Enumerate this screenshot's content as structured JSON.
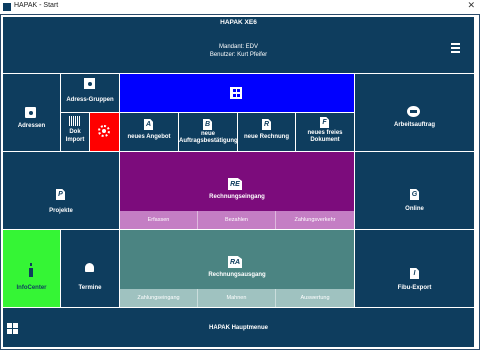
{
  "window": {
    "title": "HAPAK - Start",
    "close_glyph": "✕"
  },
  "header": {
    "title": "HAPAK XE6",
    "mandant": "Mandant: EDV",
    "benutzer": "Benutzer: Kurt Pfeifer"
  },
  "tiles": {
    "adressen": "Adressen",
    "adress_gruppen": "Adress-Gruppen",
    "dok_import_1": "Dok",
    "dok_import_2": "Import",
    "neues_angebot": "neues Angebot",
    "neue_auftragsbestaetigung_1": "neue",
    "neue_auftragsbestaetigung_2": "Auftragsbestätigung",
    "neue_rechnung": "neue Rechnung",
    "neues_freies_dokument_1": "neues freies",
    "neues_freies_dokument_2": "Dokument",
    "arbeitsauftrag": "Arbeitsauftrag",
    "projekte": "Projekte",
    "rechnungseingang": "Rechnungseingang",
    "online": "Online",
    "infocenter": "InfoCenter",
    "termine": "Termine",
    "rechnungsausgang": "Rechnungsausgang",
    "fibu_export": "Fibu-Export",
    "hauptmenue": "HAPAK  Hauptmenue"
  },
  "rechnungseingang_actions": [
    "Erfassen",
    "Bezahlen",
    "Zahlungsverkehr"
  ],
  "rechnungsausgang_actions": [
    "Zahlungseingang",
    "Mahnen",
    "Auswertung"
  ],
  "doc_letters": {
    "angebot": "A",
    "auftrag": "B",
    "rechnung": "R",
    "frei": "F",
    "re": "RE",
    "ra": "RA",
    "projekte": "P",
    "online": "G",
    "fibu": "I"
  },
  "colors": {
    "tile": "#0e3d5e",
    "blue": "#0000ff",
    "red": "#ff0000",
    "purple": "#7c0c7c",
    "purple_light": "#c47ec4",
    "teal": "#4b8482",
    "teal_light": "#9fc2c0",
    "green": "#35f535"
  }
}
